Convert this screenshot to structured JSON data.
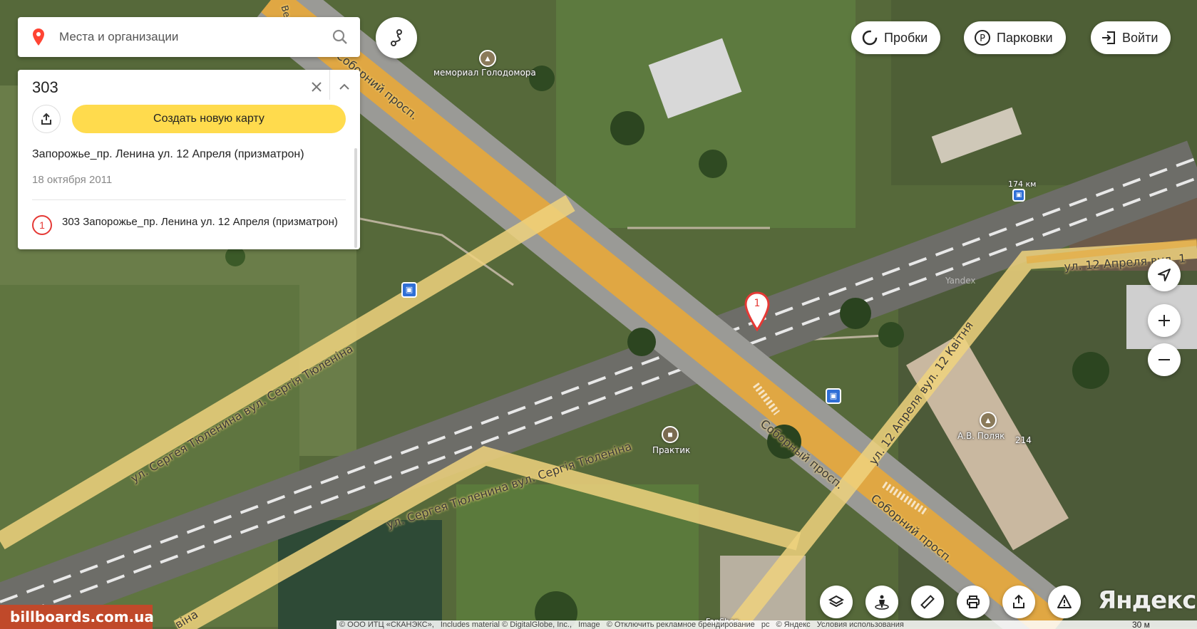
{
  "search": {
    "placeholder": "Места и организации"
  },
  "panel": {
    "title": "303",
    "create_map_label": "Создать новую карту",
    "map_name": "Запорожье_пр. Ленина ул. 12 Апреля (призматрон)",
    "date": "18 октября 2011",
    "items": [
      {
        "number": "1",
        "label": "303 Запорожье_пр. Ленина ул. 12 Апреля (призматрон)"
      }
    ]
  },
  "top_buttons": {
    "traffic": "Пробки",
    "parking": "Парковки",
    "login": "Войти"
  },
  "map": {
    "marker_number": "1",
    "labels": {
      "memorial": "мемориал Голодомора",
      "praktik": "Практик",
      "polyak": "А.В. Поляк",
      "house_214": "214",
      "km_174": "174 км",
      "yandex_small": "Yandex",
      "fanshop": "FanShop",
      "sobornyi_1": "Соборний просп.",
      "sobornyi_2": "Соборный просп.",
      "sobornyi_3": "Соборний просп.",
      "verkhnia": "Верхня",
      "tiulenina_1": "ул. Сергея Тюленина вул. Сергія Тюленіна",
      "tiulenina_2": "ул. Сергея Тюленина вул. Сергія Тюленіна",
      "tiulenina_3": "віна",
      "aprelia_1": "ул. 12 Апреля вул. 1",
      "aprelia_2": "ул. 12 Апреля вул. 12 Квітня"
    }
  },
  "footer": {
    "copyright_1": "© ООО ИТЦ «СКАНЭКС»,",
    "copyright_2": "Includes material © DigitalGlobe, Inc.,",
    "copyright_3": "Image",
    "disable_ads": "© Отключить рекламное брендирование",
    "copyright_4": "рс",
    "yandex_copy": "© Яндекс",
    "terms": "Условия использования",
    "scale": "30 м",
    "logo": "Яндекс",
    "watermark": "billboards.com.ua"
  },
  "colors": {
    "accent_yellow": "#ffdb4d",
    "marker_red": "#e53935",
    "road_yellow": "#e8a93a",
    "bus_blue": "#2f6fd6"
  }
}
